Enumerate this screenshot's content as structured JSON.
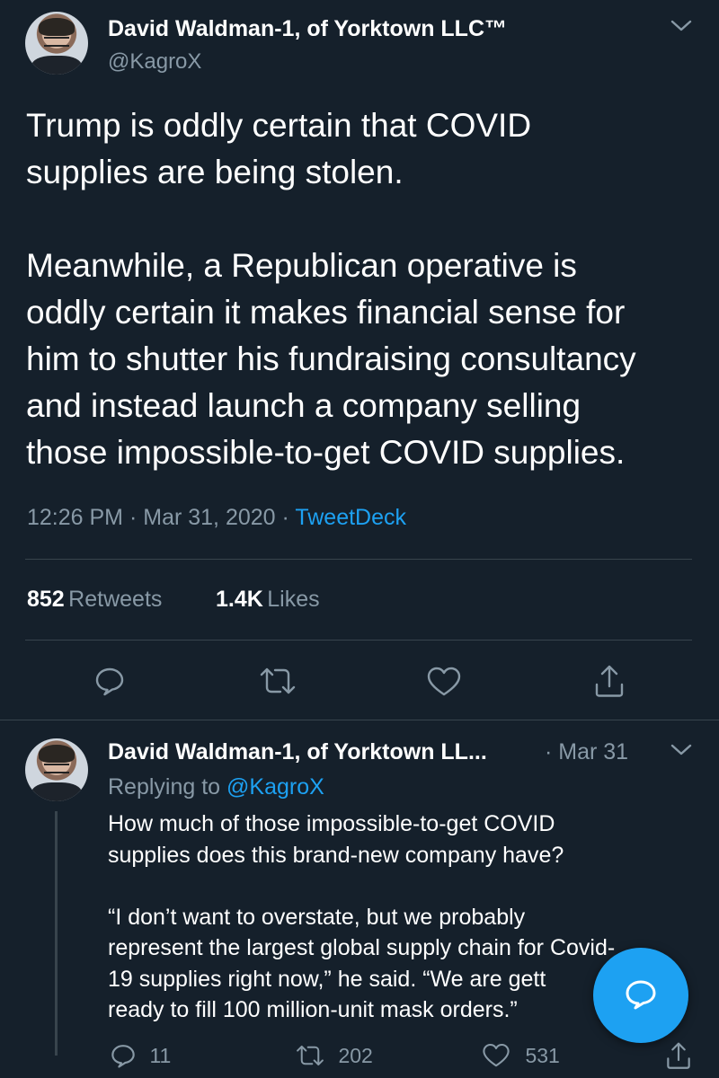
{
  "tweet": {
    "author_name": "David Waldman-1, of Yorktown LLC™",
    "author_handle": "@KagroX",
    "text": "Trump is oddly certain that COVID\nsupplies are being stolen.\n\nMeanwhile, a Republican operative is\noddly certain it makes financial sense for\nhim to shutter his fundraising consultancy\nand instead launch a company selling\nthose impossible-to-get COVID supplies.",
    "time": "12:26 PM",
    "sep1": "·",
    "date": "Mar 31, 2020",
    "sep2": "·",
    "source": "TweetDeck",
    "retweets_count": "852",
    "retweets_label": "Retweets",
    "likes_count": "1.4K",
    "likes_label": "Likes"
  },
  "reply": {
    "author_name": "David Waldman-1, of Yorktown LL...",
    "sep": "·",
    "date": "Mar 31",
    "replying_prefix": "Replying to",
    "replying_handle": "@KagroX",
    "text": "How much of those impossible-to-get COVID\nsupplies does this brand-new company have?\n\n“I don’t want to overstate, but we probably\nrepresent the largest global supply chain for Covid-\n19 supplies right now,” he said. “We are gett\nready to fill 100 million-unit mask orders.”",
    "reply_count": "11",
    "retweet_count": "202",
    "like_count": "531"
  },
  "icons": {
    "more": "chevron-down-icon",
    "reply": "reply-icon",
    "retweet": "retweet-icon",
    "like": "heart-icon",
    "share": "share-icon",
    "compose": "compose-icon"
  },
  "colors": {
    "background": "#15202b",
    "accent": "#1da1f2",
    "secondary_text": "#8899a6",
    "divider": "#38444d"
  }
}
